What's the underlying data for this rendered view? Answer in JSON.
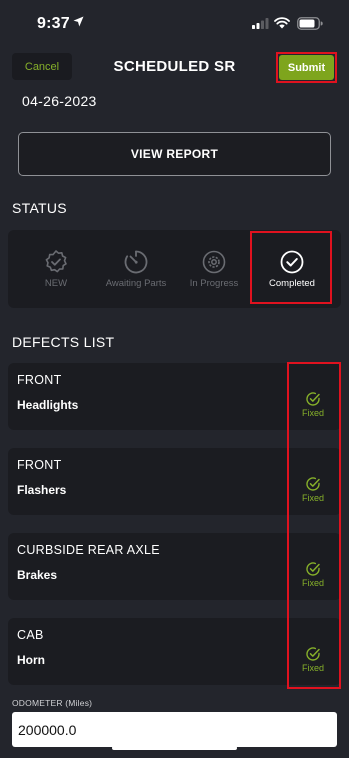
{
  "status_bar": {
    "time": "9:37",
    "icons": [
      "location-arrow-icon",
      "cellular-signal-icon",
      "wifi-icon",
      "battery-icon"
    ]
  },
  "header": {
    "cancel_label": "Cancel",
    "title": "SCHEDULED SR",
    "submit_label": "Submit"
  },
  "date": "04-26-2023",
  "view_report_label": "VIEW REPORT",
  "status_section": {
    "title": "STATUS",
    "steps": [
      {
        "label": "NEW",
        "icon": "verified-badge-icon",
        "active": false
      },
      {
        "label": "Awaiting Parts",
        "icon": "timer-icon",
        "active": false
      },
      {
        "label": "In Progress",
        "icon": "gear-icon",
        "active": false
      },
      {
        "label": "Completed",
        "icon": "check-circle-icon",
        "active": true
      }
    ]
  },
  "defects_section": {
    "title": "DEFECTS LIST",
    "items": [
      {
        "location": "FRONT",
        "name": "Headlights",
        "status": "Fixed"
      },
      {
        "location": "FRONT",
        "name": "Flashers",
        "status": "Fixed"
      },
      {
        "location": "CURBSIDE REAR AXLE",
        "name": "Brakes",
        "status": "Fixed"
      },
      {
        "location": "CAB",
        "name": "Horn",
        "status": "Fixed"
      }
    ]
  },
  "odometer": {
    "label": "ODOMETER (Miles)",
    "value": "200000.0"
  },
  "colors": {
    "background": "#23252c",
    "card": "#1b1c21",
    "accent_green": "#7ea51d",
    "fixed_green": "#86b02a",
    "highlight_red": "#e0121f",
    "inactive_gray": "#6a6c72"
  }
}
